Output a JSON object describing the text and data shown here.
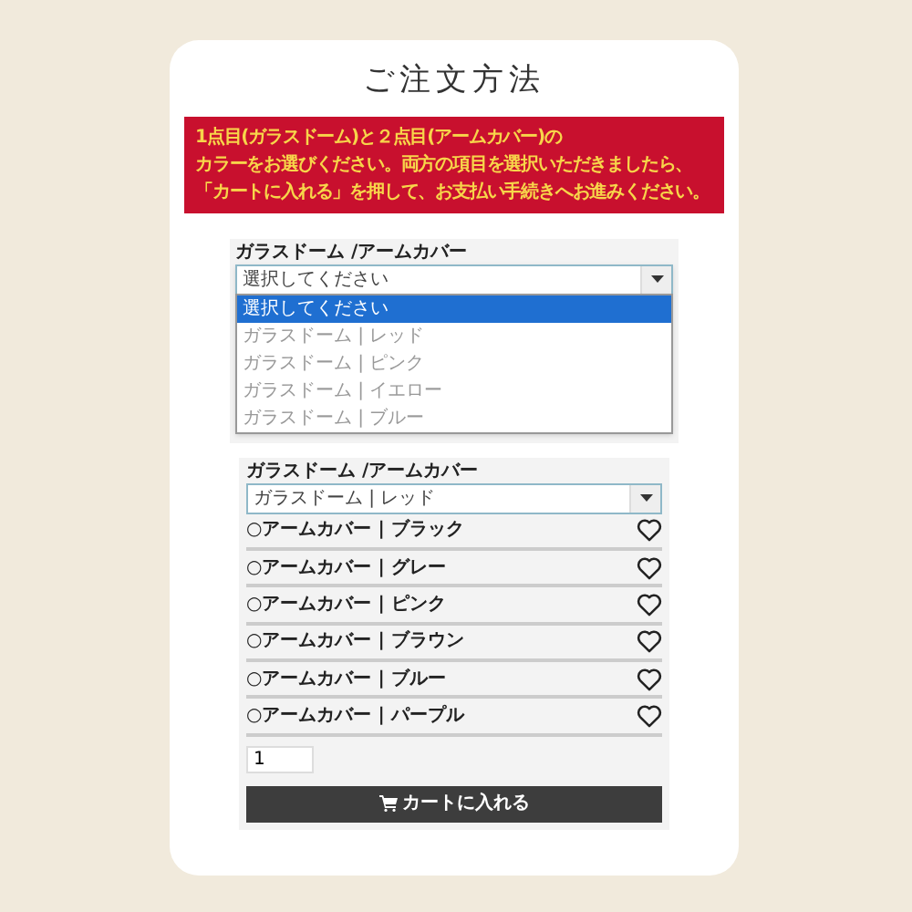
{
  "title": "ご注文方法",
  "notice": [
    "1点目(ガラスドーム)と２点目(アームカバー)の",
    "カラーをお選びください。両方の項目を選択いただきましたら、",
    "「カートに入れる」を押して、お支払い手続きへお進みください。"
  ],
  "product_top": {
    "label": "ガラスドーム /アームカバー",
    "select": {
      "value": "選択してください",
      "expanded": true,
      "options": [
        {
          "label": "選択してください",
          "selected": true
        },
        {
          "label": "ガラスドーム | レッド",
          "selected": false
        },
        {
          "label": "ガラスドーム | ピンク",
          "selected": false
        },
        {
          "label": "ガラスドーム | イエロー",
          "selected": false
        },
        {
          "label": "ガラスドーム | ブルー",
          "selected": false
        }
      ]
    }
  },
  "product_bottom": {
    "label": "ガラスドーム /アームカバー",
    "select": {
      "value": "ガラスドーム | レッド"
    },
    "options": [
      {
        "label": "○アームカバー | ブラック"
      },
      {
        "label": "○アームカバー | グレー"
      },
      {
        "label": "○アームカバー | ピンク"
      },
      {
        "label": "○アームカバー | ブラウン"
      },
      {
        "label": "○アームカバー | ブルー"
      },
      {
        "label": "○アームカバー | パープル"
      }
    ],
    "quantity": "1",
    "cart_button": "カートに入れる"
  }
}
